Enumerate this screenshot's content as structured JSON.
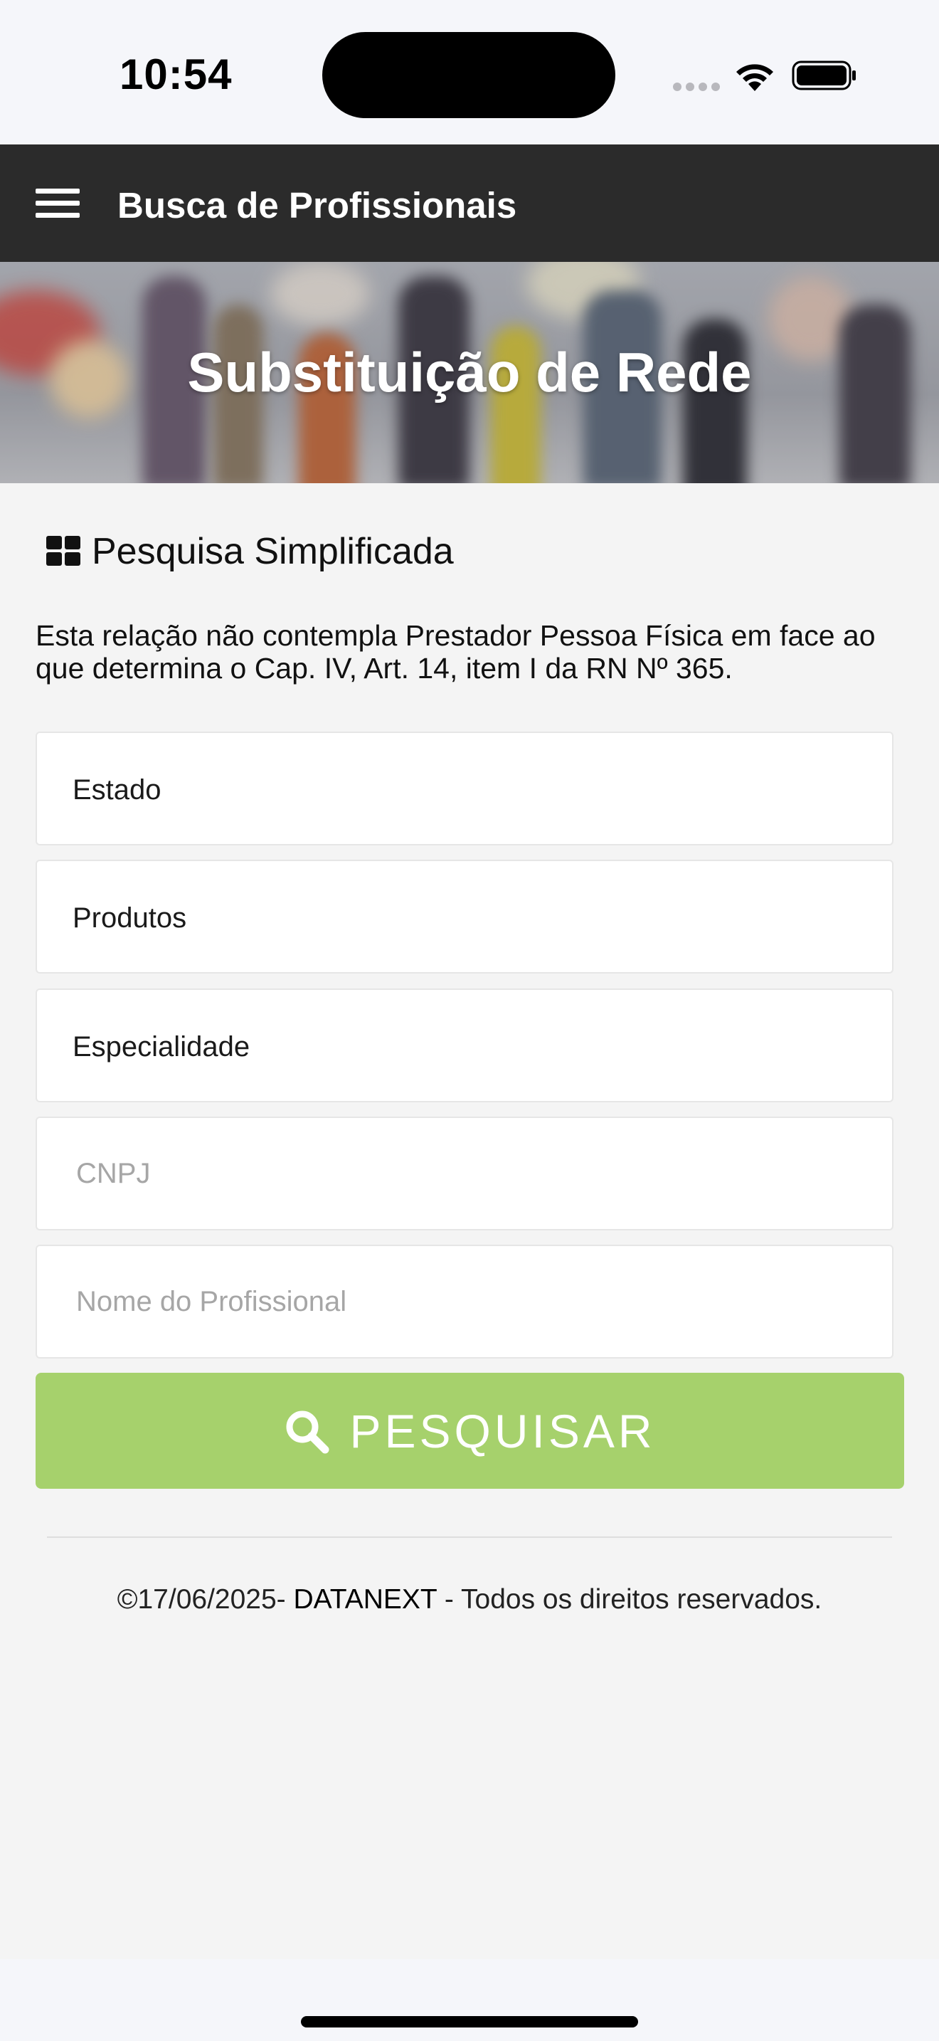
{
  "status_bar": {
    "time": "10:54"
  },
  "header": {
    "title": "Busca de Profissionais",
    "menu_icon": "hamburger-menu-icon"
  },
  "banner": {
    "title": "Substituição de Rede"
  },
  "section": {
    "icon": "grid-icon",
    "title": "Pesquisa Simplificada",
    "notice": "Esta relação não contempla Prestador Pessoa Física em face ao que determina o Cap. IV, Art. 14, item I da RN Nº 365."
  },
  "form": {
    "estado_label": "Estado",
    "produtos_label": "Produtos",
    "especialidade_label": "Especialidade",
    "cnpj_placeholder": "CNPJ",
    "nome_placeholder": "Nome do Profissional",
    "search_label": "PESQUISAR",
    "search_icon": "search-icon"
  },
  "footer": {
    "prefix": "©17/06/2025- ",
    "brand": "DATANEXT",
    "suffix": " - Todos os direitos reservados."
  },
  "colors": {
    "header_bg": "#2b2b2b",
    "button_bg": "#a6d16c",
    "page_bg": "#f4f4f4"
  }
}
